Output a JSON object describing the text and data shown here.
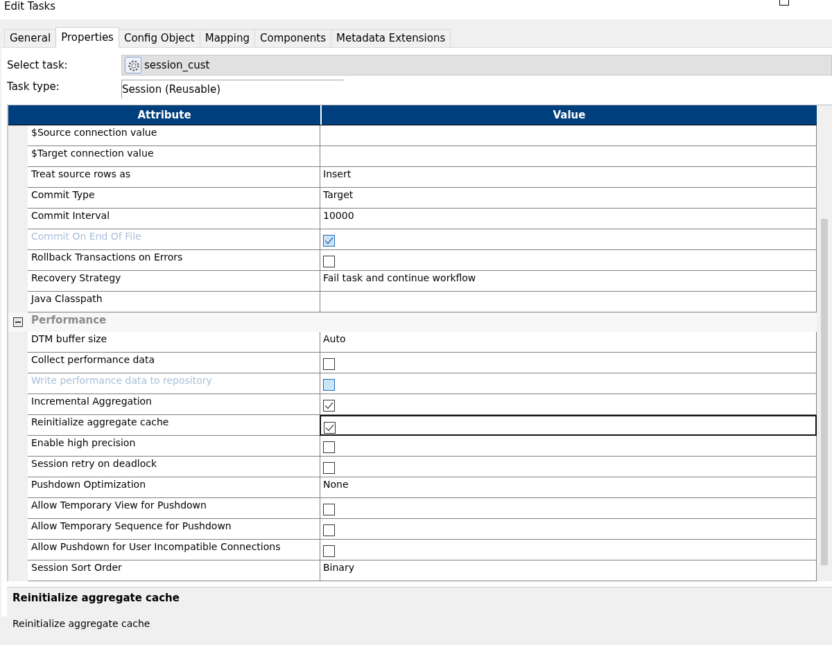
{
  "window": {
    "title": "Edit Tasks"
  },
  "tabs": [
    {
      "label": "General",
      "selected": false
    },
    {
      "label": "Properties",
      "selected": true
    },
    {
      "label": "Config Object",
      "selected": false
    },
    {
      "label": "Mapping",
      "selected": false
    },
    {
      "label": "Components",
      "selected": false
    },
    {
      "label": "Metadata Extensions",
      "selected": false
    }
  ],
  "select_task": {
    "label": "Select task:",
    "value": "session_cust"
  },
  "task_type": {
    "label": "Task type:",
    "value": "Session (Reusable)"
  },
  "table": {
    "columns": [
      "Attribute",
      "Value"
    ],
    "rows": [
      {
        "attribute": "$Source connection value",
        "kind": "text",
        "value": "",
        "disabled": false,
        "selected": false
      },
      {
        "attribute": "$Target connection value",
        "kind": "text",
        "value": "",
        "disabled": false,
        "selected": false
      },
      {
        "attribute": "Treat source rows as",
        "kind": "text",
        "value": "Insert",
        "disabled": false,
        "selected": false
      },
      {
        "attribute": "Commit Type",
        "kind": "text",
        "value": "Target",
        "disabled": false,
        "selected": false
      },
      {
        "attribute": "Commit Interval",
        "kind": "text",
        "value": "10000",
        "disabled": false,
        "selected": false
      },
      {
        "attribute": "Commit On End Of File",
        "kind": "checkbox",
        "checked": true,
        "disabled": true,
        "selected": false
      },
      {
        "attribute": "Rollback Transactions on Errors",
        "kind": "checkbox",
        "checked": false,
        "disabled": false,
        "selected": false
      },
      {
        "attribute": "Recovery Strategy",
        "kind": "text",
        "value": "Fail task and continue workflow",
        "disabled": false,
        "selected": false
      },
      {
        "attribute": "Java Classpath",
        "kind": "text",
        "value": "",
        "disabled": false,
        "selected": false
      }
    ],
    "groups": [
      {
        "label": "Performance",
        "expanded": true,
        "children": [
          {
            "attribute": "DTM buffer size",
            "kind": "text",
            "value": "Auto",
            "disabled": false,
            "selected": false
          },
          {
            "attribute": "Collect performance data",
            "kind": "checkbox",
            "checked": false,
            "disabled": false,
            "selected": false
          },
          {
            "attribute": "Write performance data to repository",
            "kind": "checkbox",
            "checked": false,
            "disabled": true,
            "selected": false
          },
          {
            "attribute": "Incremental Aggregation",
            "kind": "checkbox",
            "checked": true,
            "disabled": false,
            "selected": false
          },
          {
            "attribute": "Reinitialize aggregate cache",
            "kind": "checkbox",
            "checked": true,
            "disabled": false,
            "selected": true
          },
          {
            "attribute": "Enable high precision",
            "kind": "checkbox",
            "checked": false,
            "disabled": false,
            "selected": false
          },
          {
            "attribute": "Session retry on deadlock",
            "kind": "checkbox",
            "checked": false,
            "disabled": false,
            "selected": false
          },
          {
            "attribute": "Pushdown Optimization",
            "kind": "text",
            "value": "None",
            "disabled": false,
            "selected": false
          },
          {
            "attribute": "Allow Temporary View for Pushdown",
            "kind": "checkbox",
            "checked": false,
            "disabled": false,
            "selected": false
          },
          {
            "attribute": "Allow Temporary Sequence for Pushdown",
            "kind": "checkbox",
            "checked": false,
            "disabled": false,
            "selected": false
          },
          {
            "attribute": "Allow Pushdown for User Incompatible Connections",
            "kind": "checkbox",
            "checked": false,
            "disabled": false,
            "selected": false
          },
          {
            "attribute": "Session Sort Order",
            "kind": "text",
            "value": "Binary",
            "disabled": false,
            "selected": false
          }
        ]
      }
    ]
  },
  "description": {
    "title": "Reinitialize aggregate cache",
    "text": "Reinitialize aggregate cache"
  }
}
